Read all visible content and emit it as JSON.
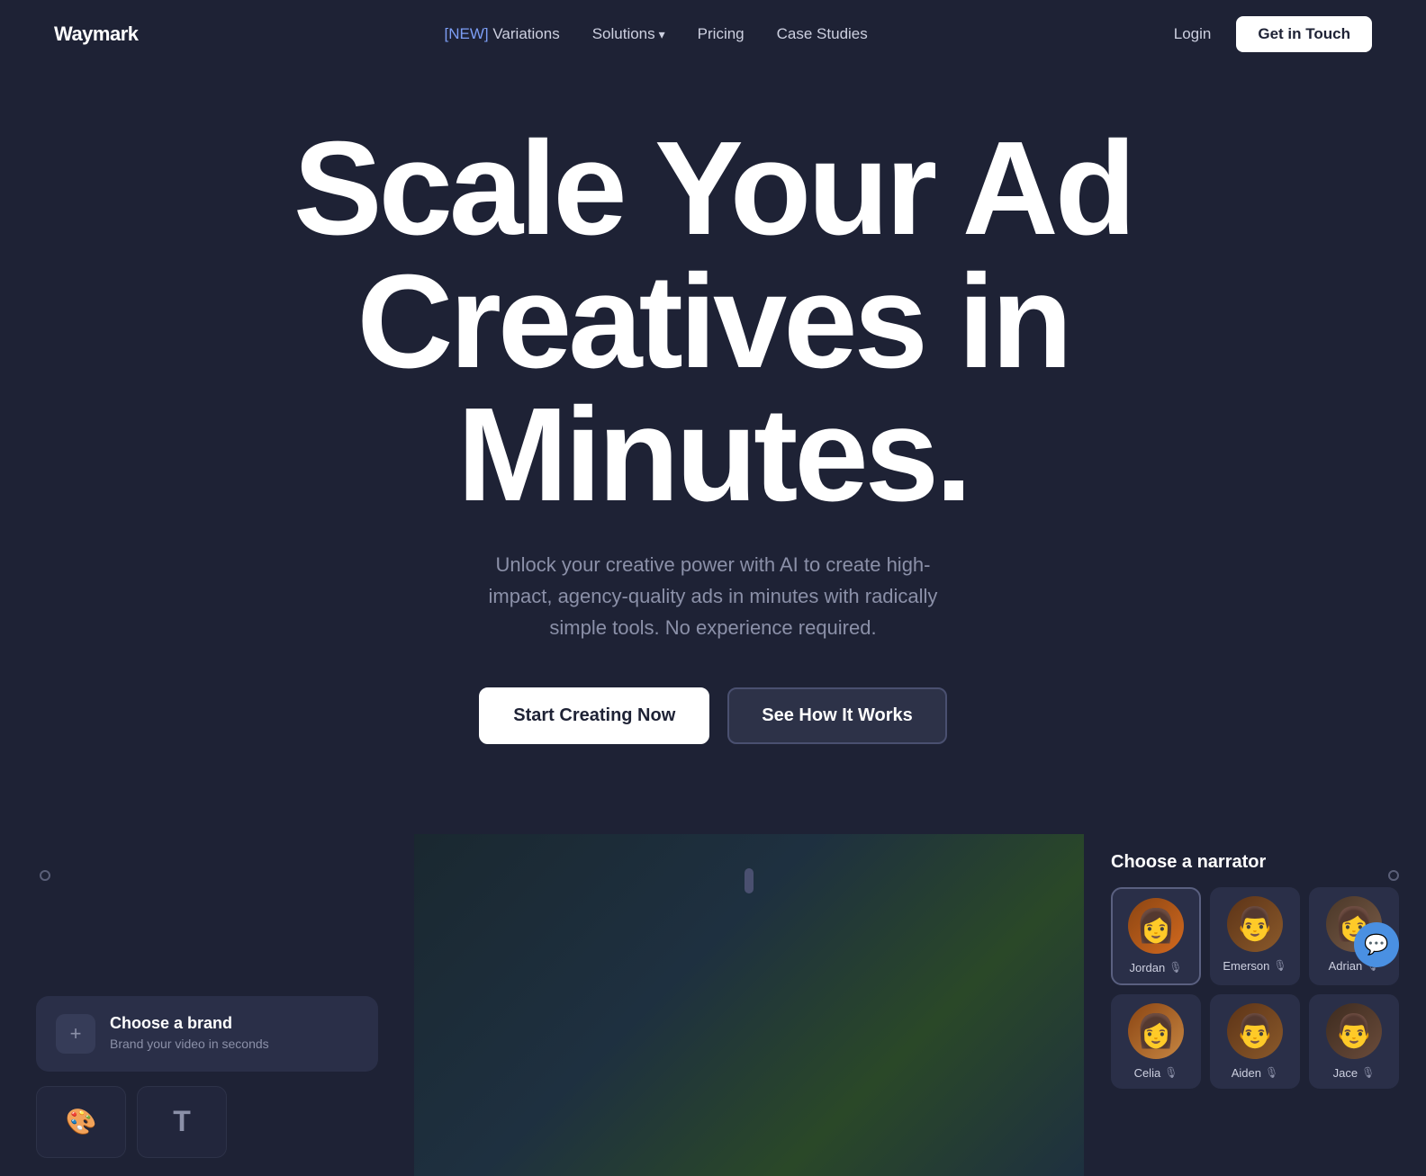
{
  "brand": {
    "logo": "Waymark"
  },
  "navbar": {
    "new_badge": "[NEW]",
    "variations": "Variations",
    "solutions": "Solutions",
    "pricing": "Pricing",
    "case_studies": "Case Studies",
    "login": "Login",
    "cta": "Get in Touch"
  },
  "hero": {
    "title_line1": "Scale Your Ad",
    "title_line2": "Creatives in",
    "title_line3": "Minutes.",
    "subtitle": "Unlock your creative power with AI to create high-impact, agency-quality ads in minutes with radically simple tools. No experience required.",
    "btn_primary": "Start Creating Now",
    "btn_secondary": "See How It Works"
  },
  "bottom": {
    "choose_brand": {
      "label": "Choose a brand",
      "description": "Brand your video in seconds"
    },
    "narrator": {
      "title": "Choose a narrator",
      "narrators": [
        {
          "name": "Jordan",
          "emoji": "👩"
        },
        {
          "name": "Emerson",
          "emoji": "👨"
        },
        {
          "name": "Adrian",
          "emoji": "👩"
        },
        {
          "name": "Celia",
          "emoji": "👩"
        },
        {
          "name": "Aiden",
          "emoji": "👨"
        },
        {
          "name": "Jace",
          "emoji": "👨"
        }
      ]
    }
  },
  "icons": {
    "plus": "+",
    "palette": "🎨",
    "text": "T",
    "chevron_down": "▾",
    "mic": "🎙",
    "chat": "💬"
  }
}
